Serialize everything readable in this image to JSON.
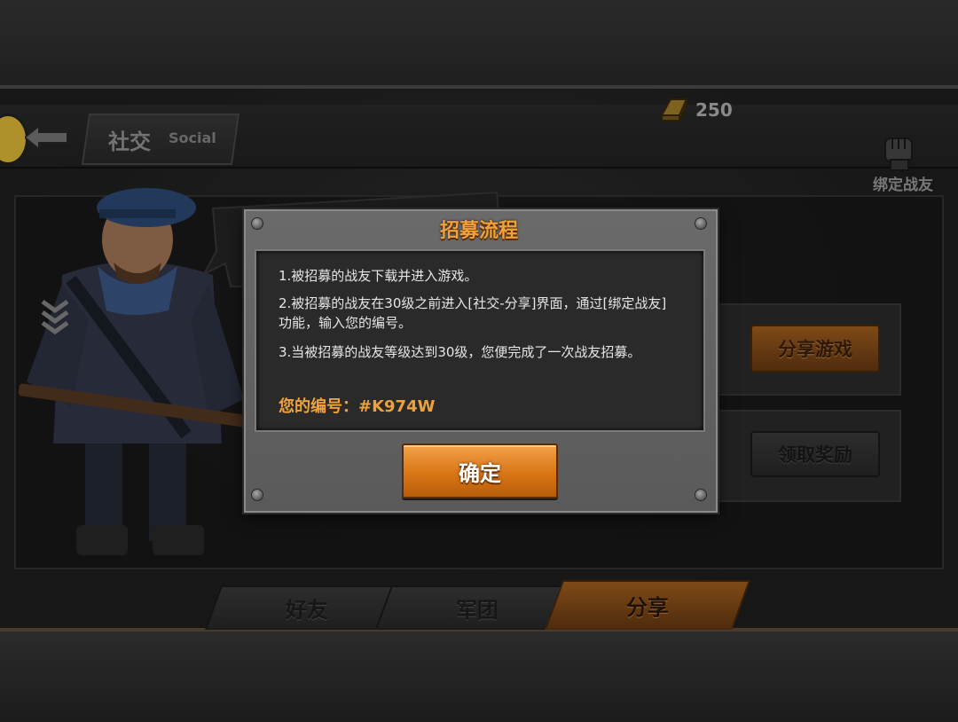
{
  "header": {
    "title_cn": "社交",
    "title_en": "Social",
    "gold_amount": "250",
    "bind_label": "绑定战友"
  },
  "side_buttons": {
    "share_game": "分享游戏",
    "claim_reward": "领取奖励"
  },
  "tabs": [
    {
      "label": "好友",
      "active": false
    },
    {
      "label": "军团",
      "active": false
    },
    {
      "label": "分享",
      "active": true
    }
  ],
  "dialog": {
    "title": "招募流程",
    "steps": [
      "1.被招募的战友下载并进入游戏。",
      "2.被招募的战友在30级之前进入[社交-分享]界面，通过[绑定战友]功能，输入您的编号。",
      "3.当被招募的战友等级达到30级，您便完成了一次战友招募。"
    ],
    "code_text": "您的编号：#K974W",
    "confirm_label": "确定"
  },
  "colors": {
    "accent_orange": "#f0a23a",
    "button_orange": "#d97616",
    "panel_gray": "#5a5a5a"
  }
}
